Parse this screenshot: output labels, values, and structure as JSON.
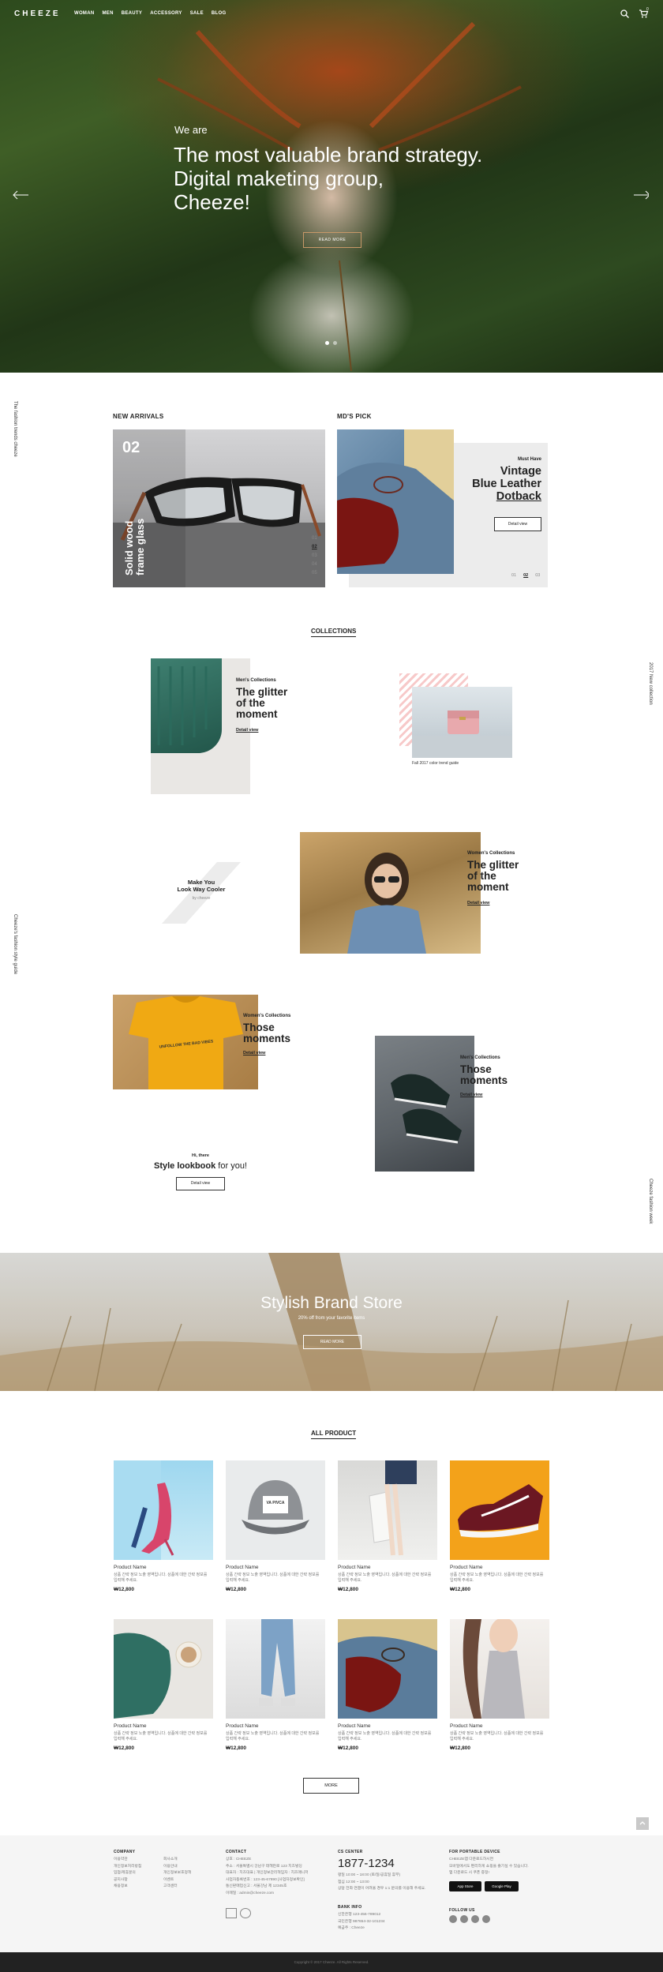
{
  "header": {
    "logo": "CHEEZE",
    "menu": [
      "WOMAN",
      "MEN",
      "BEAUTY",
      "ACCESSORY",
      "SALE",
      "BLOG"
    ],
    "cart_count": "0"
  },
  "hero": {
    "pre": "We are",
    "title_lines": [
      "The most valuable brand strategy.",
      "Digital maketing group,",
      "Cheeze!"
    ],
    "button": "READ MORE"
  },
  "side_texts": {
    "left_1": "The fashion trends cheeze",
    "right_1": "2017 New collection",
    "left_2": "Cheeze's fashion style guide",
    "right_2": "Cheeze fashion week"
  },
  "new_arrivals": {
    "heading": "NEW ARRIVALS",
    "number": "02",
    "caption_lines": [
      "Solid wood",
      "frame glass"
    ],
    "pager": [
      "01",
      "02",
      "03",
      "04",
      "05"
    ]
  },
  "mds_pick": {
    "heading": "MD'S PICK",
    "badge": "Must Have",
    "title_lines": [
      "Vintage",
      "Blue Leather",
      "Dotback"
    ],
    "button": "Detail view",
    "pager": [
      "01",
      "02",
      "03"
    ]
  },
  "collections": {
    "heading": "COLLECTIONS",
    "c1": {
      "tag": "Men's Collections",
      "title_lines": [
        "The glitter",
        "of the",
        "moment"
      ],
      "link": "Detail view"
    },
    "bag_caption": "Fall 2017 color trend guide",
    "c2_quote": {
      "lines": [
        "Make You",
        "Look Way Cooler"
      ],
      "by": "by cheeze"
    },
    "c3": {
      "tag": "Women's Collections",
      "title_lines": [
        "The glitter",
        "of the",
        "moment"
      ],
      "link": "Detail view"
    },
    "c4": {
      "tag": "Women's Collections",
      "title_lines": [
        "Those",
        "moments"
      ],
      "link": "Detail view",
      "tshirt_text": "UNFOLLOW THE BAD VIBES"
    },
    "c5": {
      "tag": "Men's Collections",
      "title_lines": [
        "Those",
        "moments"
      ],
      "link": "Detail view"
    },
    "lookbook": {
      "pre": "Hi, there",
      "title_bold": "Style lookbook",
      "title_rest": " for you!",
      "button": "Detail view"
    }
  },
  "banner": {
    "title": "Stylish Brand Store",
    "sub": "20% off from your favorite items",
    "button": "READ MORE"
  },
  "all_product": {
    "heading": "ALL PRODUCT",
    "items": [
      {
        "name": "Product Name",
        "desc": "상품 간략 정보 노출 영역입니다. 상품에 대한 간략 정보를 입력해 주세요.",
        "price": "₩12,800",
        "icon": "heels-image"
      },
      {
        "name": "Product Name",
        "desc": "상품 간략 정보 노출 영역입니다. 상품에 대한 간략 정보를 입력해 주세요.",
        "price": "₩12,800",
        "icon": "cap-image",
        "cap_text": "VA PIVCA"
      },
      {
        "name": "Product Name",
        "desc": "상품 간략 정보 노출 영역입니다. 상품에 대한 간략 정보를 입력해 주세요.",
        "price": "₩12,800",
        "icon": "tote-bag-image"
      },
      {
        "name": "Product Name",
        "desc": "상품 간략 정보 노출 영역입니다. 상품에 대한 간략 정보를 입력해 주세요.",
        "price": "₩12,800",
        "icon": "sneaker-image"
      },
      {
        "name": "Product Name",
        "desc": "상품 간략 정보 노출 영역입니다. 상품에 대한 간략 정보를 입력해 주세요.",
        "price": "₩12,800",
        "icon": "knit-image"
      },
      {
        "name": "Product Name",
        "desc": "상품 간략 정보 노출 영역입니다. 상품에 대한 간략 정보를 입력해 주세요.",
        "price": "₩12,800",
        "icon": "jeans-image"
      },
      {
        "name": "Product Name",
        "desc": "상품 간략 정보 노출 영역입니다. 상품에 대한 간략 정보를 입력해 주세요.",
        "price": "₩12,800",
        "icon": "leather-bag-image"
      },
      {
        "name": "Product Name",
        "desc": "상품 간략 정보 노출 영역입니다. 상품에 대한 간략 정보를 입력해 주세요.",
        "price": "₩12,800",
        "icon": "tanktop-image"
      }
    ],
    "more_button": "MORE"
  },
  "footer": {
    "company": {
      "heading": "COMPANY",
      "col1": [
        "이용약관",
        "개인정보처리방침",
        "입점/제휴문의",
        "공지사항",
        "채용정보"
      ],
      "col2": [
        "회사소개",
        "이용안내",
        "개인정보보호정책",
        "이벤트",
        "고객센터"
      ]
    },
    "contact": {
      "heading": "CONTACT",
      "lines": [
        "상호 : CHEEZE",
        "주소 : 서울특별시 강남구 테헤란로 123 치즈빌딩",
        "대표자 : 치즈대표  |  개인정보관리책임자 : 치즈매니저",
        "사업자등록번호 : 123-45-67890 [사업자정보확인]",
        "통신판매업신고 : 서울강남 제 12345호",
        "이메일 : admin@cheeze.com"
      ]
    },
    "cs": {
      "heading": "CS CENTER",
      "phone": "1877-1234",
      "lines": [
        "평일 10:00 ~ 18:00 (토/일/공휴일 휴무)",
        "점심 12:00 ~ 13:00",
        "상담 전화 연결이 어려울 경우 1:1 문의를 이용해 주세요."
      ]
    },
    "bank": {
      "heading": "BANK INFO",
      "lines": [
        "신한은행   123-456-789012",
        "국민은행   987654-32-101234",
        "예금주 : Cheeze"
      ]
    },
    "portable": {
      "heading": "FOR PORTABLE DEVICE",
      "desc": [
        "CHEEZE앱 다운로드하시면",
        "모바일에서도 편리하게 쇼핑을 즐기실 수 있습니다.",
        "앱 다운로드 시 쿠폰 증정!"
      ],
      "appstore": "App Store",
      "googleplay": "Google Play"
    },
    "follow": {
      "heading": "FOLLOW US"
    },
    "copyright": "Copyright © 2017 Cheeze. All Rights Reserved."
  }
}
